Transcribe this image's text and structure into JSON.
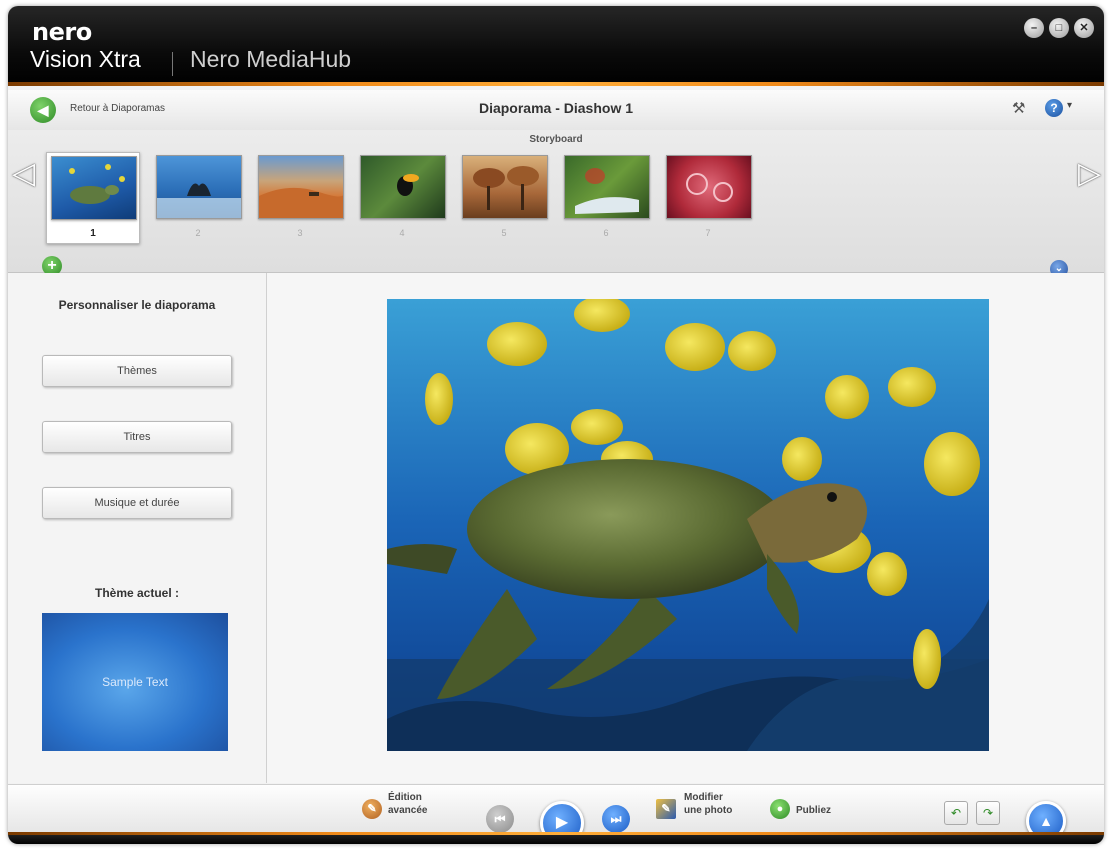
{
  "window": {
    "brand": "nero",
    "app_name": "Vision Xtra",
    "secondary_app": "Nero MediaHub",
    "controls": [
      "minimize",
      "maximize",
      "close"
    ]
  },
  "header": {
    "back_label": "Retour à Diaporamas",
    "title": "Diaporama - Diashow 1"
  },
  "storyboard": {
    "label": "Storyboard",
    "selected": 1,
    "thumbnails": [
      {
        "number": "1",
        "subject": "sea turtle"
      },
      {
        "number": "2",
        "subject": "whale tail"
      },
      {
        "number": "3",
        "subject": "desert dunes"
      },
      {
        "number": "4",
        "subject": "toucan"
      },
      {
        "number": "5",
        "subject": "autumn trees"
      },
      {
        "number": "6",
        "subject": "waterfall stream"
      },
      {
        "number": "7",
        "subject": "red flowers"
      }
    ]
  },
  "left_panel": {
    "title": "Personnaliser le diaporama",
    "buttons": [
      "Thèmes",
      "Titres",
      "Musique et durée"
    ],
    "current_theme_label": "Thème actuel :",
    "theme_preview_text": "Sample Text"
  },
  "bottom_bar": {
    "edit_advanced": "Édition\navancée",
    "edit_photo": "Modifier\nune photo",
    "publish": "Publiez"
  },
  "colors": {
    "accent_orange": "#f08a1a",
    "accent_blue": "#1a5bc4",
    "accent_green": "#2e8a26"
  }
}
